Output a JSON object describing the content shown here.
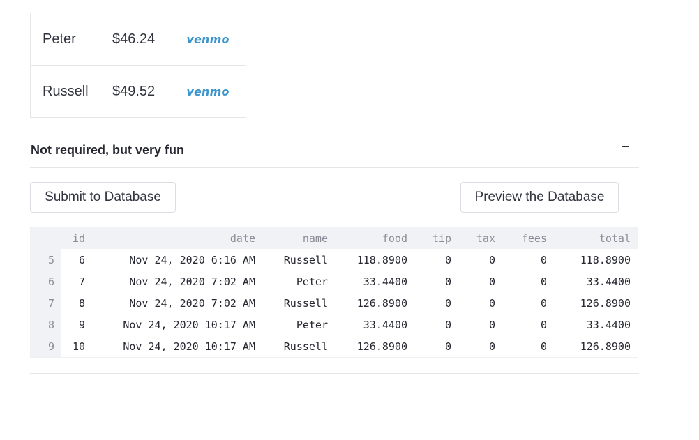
{
  "payments": [
    {
      "name": "Peter",
      "amount": "$46.24",
      "pay_label": "venmo"
    },
    {
      "name": "Russell",
      "amount": "$49.52",
      "pay_label": "venmo"
    }
  ],
  "expander": {
    "label": "Not required, but very fun",
    "icon": "minus-icon"
  },
  "buttons": {
    "submit": "Submit to Database",
    "preview": "Preview the Database"
  },
  "dataframe": {
    "columns": [
      "id",
      "date",
      "name",
      "food",
      "tip",
      "tax",
      "fees",
      "total"
    ],
    "rows": [
      {
        "index": "5",
        "cells": [
          "6",
          "Nov 24, 2020 6:16 AM",
          "Russell",
          "118.8900",
          "0",
          "0",
          "0",
          "118.8900"
        ]
      },
      {
        "index": "6",
        "cells": [
          "7",
          "Nov 24, 2020 7:02 AM",
          "Peter",
          "33.4400",
          "0",
          "0",
          "0",
          "33.4400"
        ]
      },
      {
        "index": "7",
        "cells": [
          "8",
          "Nov 24, 2020 7:02 AM",
          "Russell",
          "126.8900",
          "0",
          "0",
          "0",
          "126.8900"
        ]
      },
      {
        "index": "8",
        "cells": [
          "9",
          "Nov 24, 2020 10:17 AM",
          "Peter",
          "33.4400",
          "0",
          "0",
          "0",
          "33.4400"
        ]
      },
      {
        "index": "9",
        "cells": [
          "10",
          "Nov 24, 2020 10:17 AM",
          "Russell",
          "126.8900",
          "0",
          "0",
          "0",
          "126.8900"
        ]
      }
    ]
  },
  "colors": {
    "venmo": "#3d95ce",
    "header_bg": "#f0f2f6",
    "border": "#e6e6ea"
  }
}
